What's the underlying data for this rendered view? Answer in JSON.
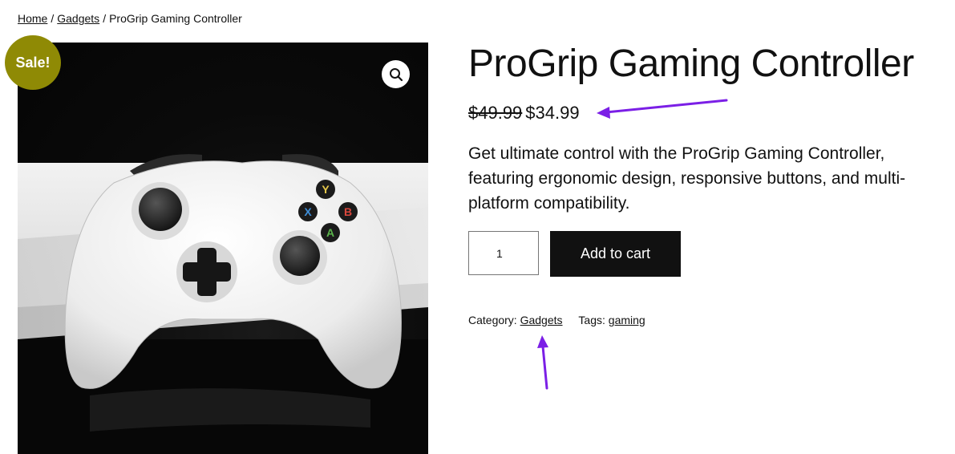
{
  "breadcrumb": {
    "home": "Home",
    "category": "Gadgets",
    "current": "ProGrip Gaming Controller",
    "separator": "/"
  },
  "badge": {
    "sale": "Sale!"
  },
  "icons": {
    "zoom": "magnifier-icon"
  },
  "product": {
    "title": "ProGrip Gaming Controller",
    "regular_price": "$49.99",
    "sale_price": "$34.99",
    "description": "Get ultimate control with the ProGrip Gaming Controller, featuring ergonomic design, responsive buttons, and multi-platform compatibility.",
    "image": {
      "subject": "white game controller",
      "button_letters": [
        "Y",
        "B",
        "X",
        "A"
      ]
    }
  },
  "cart": {
    "quantity": "1",
    "add_label": "Add to cart"
  },
  "meta": {
    "category_label": "Category:",
    "category_value": "Gadgets",
    "tags_label": "Tags:",
    "tags_value": "gaming"
  },
  "colors": {
    "sale_badge": "#8f8a05",
    "button": "#111111",
    "annotation_arrow": "#7b1fe6"
  }
}
